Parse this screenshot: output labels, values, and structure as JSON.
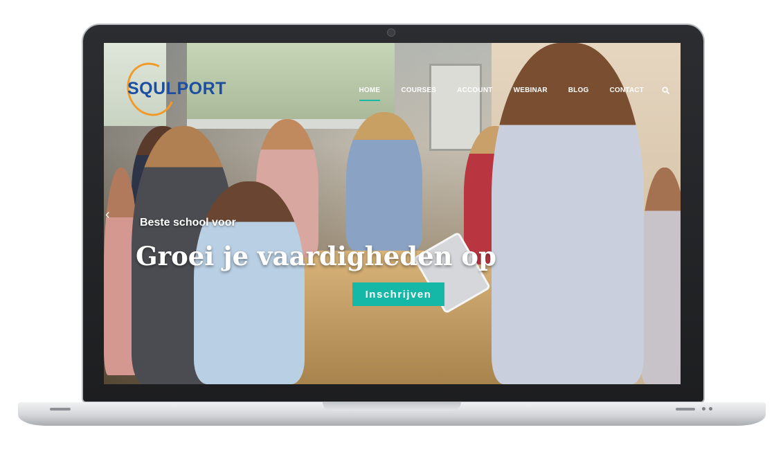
{
  "site": {
    "logo_text": "SQULPORT"
  },
  "nav": {
    "items": [
      {
        "label": "HOME",
        "active": true
      },
      {
        "label": "COURSES",
        "active": false
      },
      {
        "label": "ACCOUNT",
        "active": false
      },
      {
        "label": "WEBINAR",
        "active": false
      },
      {
        "label": "BLOG",
        "active": false
      },
      {
        "label": "CONTACT",
        "active": false
      }
    ],
    "search_icon": "search-icon"
  },
  "hero": {
    "kicker": "Beste school voor",
    "title": "Groei je vaardigheden op",
    "cta_label": "Inschrijven",
    "prev_arrow": "‹"
  },
  "colors": {
    "accent": "#15b8a6",
    "logo_blue": "#1d4ea0",
    "logo_orange": "#ef9a2a"
  }
}
